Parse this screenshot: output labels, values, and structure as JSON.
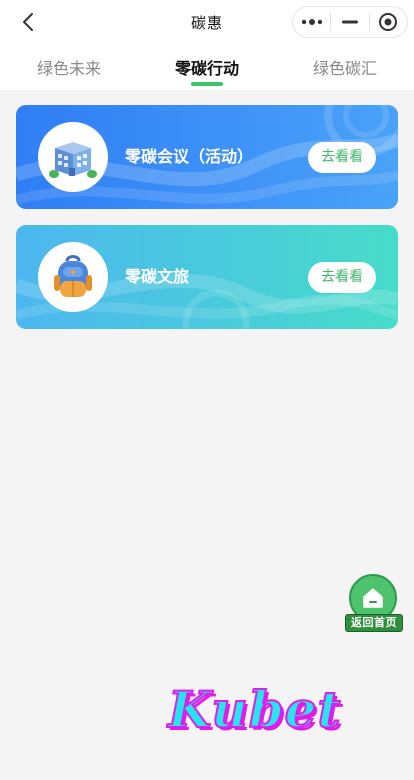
{
  "header": {
    "title": "碳惠"
  },
  "tabs": [
    {
      "label": "绿色未来",
      "active": false
    },
    {
      "label": "零碳行动",
      "active": true
    },
    {
      "label": "绿色碳汇",
      "active": false
    }
  ],
  "cards": [
    {
      "title": "零碳会议（活动）",
      "action": "去看看",
      "icon": "building-icon"
    },
    {
      "title": "零碳文旅",
      "action": "去看看",
      "icon": "backpack-icon"
    }
  ],
  "home_fab": {
    "label": "返回首页",
    "icon": "home-icon"
  },
  "watermark": "Kubet",
  "colors": {
    "accent_green": "#3cc36a",
    "card1_gradient": [
      "#2f7ef6",
      "#4aa2f8"
    ],
    "card2_gradient": [
      "#4cb7f0",
      "#47dcc9"
    ],
    "watermark_fill": "#28e4f0",
    "watermark_stroke": "#e01ce8"
  }
}
